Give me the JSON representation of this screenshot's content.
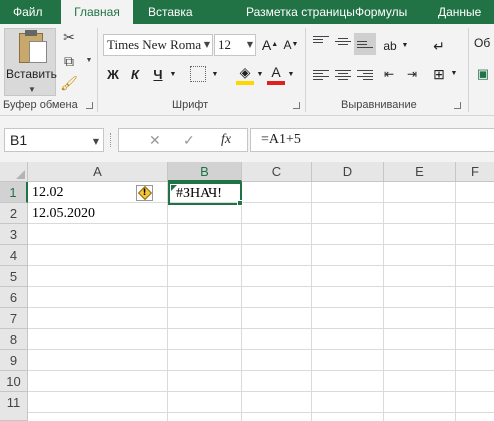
{
  "tabs": [
    "Файл",
    "Главная",
    "Вставка",
    "Разметка страницы",
    "Формулы",
    "Данные"
  ],
  "active_tab": "Главная",
  "clipboard": {
    "paste_label": "Вставить",
    "group_label": "Буфер обмена"
  },
  "font": {
    "font_name": "Times New Roma",
    "font_size": "12",
    "group_label": "Шрифт",
    "bold": "Ж",
    "italic": "К",
    "underline": "Ч",
    "font_color_glyph": "А"
  },
  "alignment": {
    "group_label": "Выравнивание"
  },
  "number_group_partial": "Об",
  "formula_bar": {
    "name_box": "B1",
    "formula": "=A1+5",
    "fx": "fx"
  },
  "columns": [
    "A",
    "B",
    "C",
    "D",
    "E",
    "F"
  ],
  "rows": [
    "1",
    "2",
    "3",
    "4",
    "5",
    "6",
    "7",
    "8",
    "9",
    "10",
    "11"
  ],
  "selected_cell": "B1",
  "cells": {
    "A1": "12.02",
    "A2": "12.05.2020",
    "B1": "#ЗНАЧ!"
  },
  "colors": {
    "accent": "#217346",
    "ribbon": "#f3f3f3",
    "fill_yellow": "#ffd700",
    "font_red": "#e02020"
  }
}
